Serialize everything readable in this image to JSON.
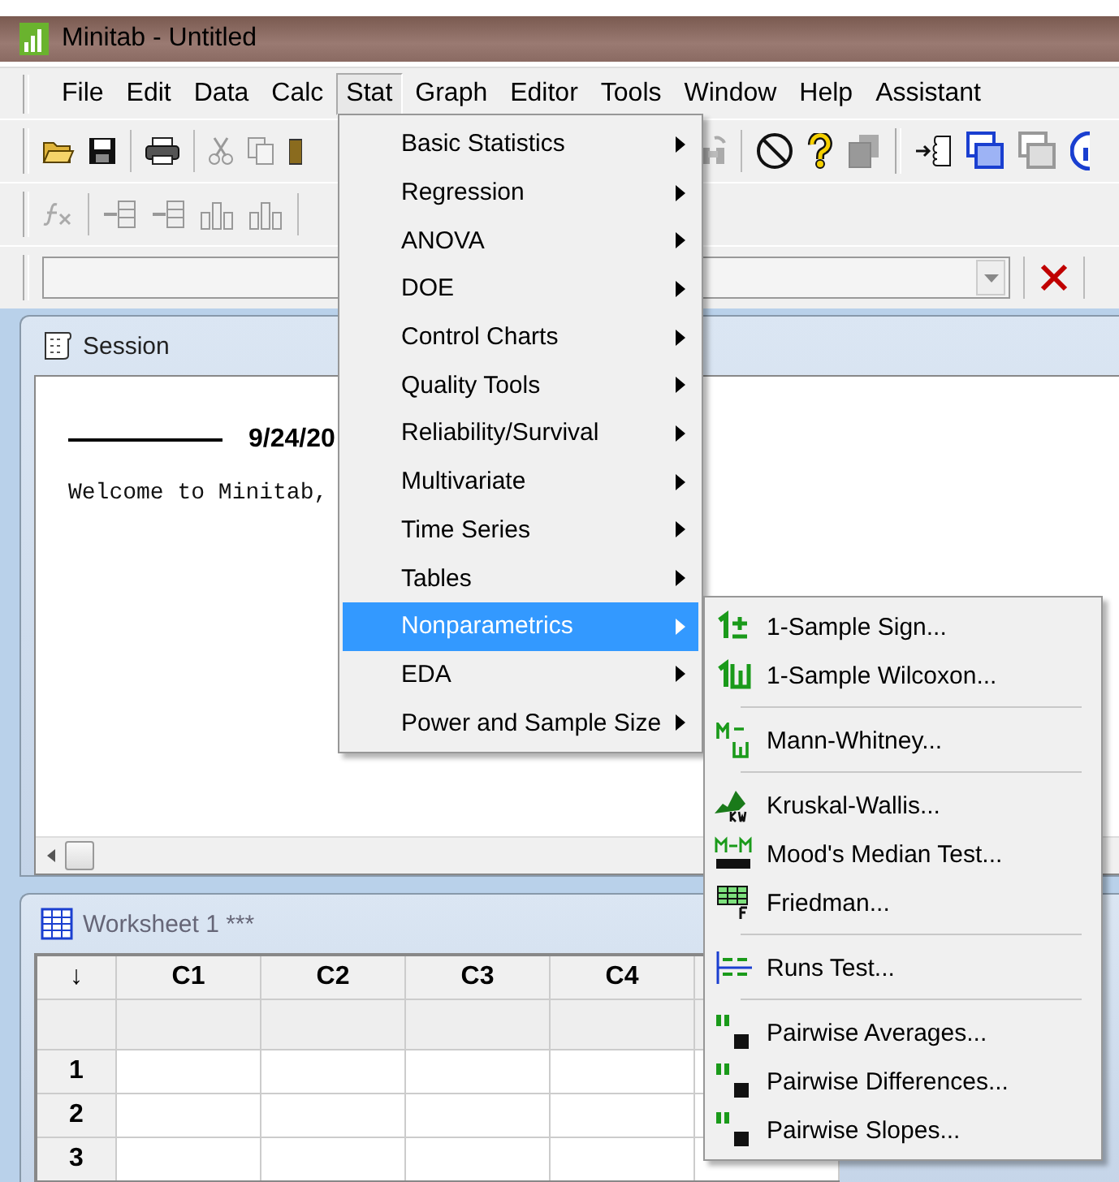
{
  "window": {
    "title": "Minitab - Untitled"
  },
  "menu_bar": [
    {
      "label": "File",
      "selected": false
    },
    {
      "label": "Edit",
      "selected": false
    },
    {
      "label": "Data",
      "selected": false
    },
    {
      "label": "Calc",
      "selected": false
    },
    {
      "label": "Stat",
      "selected": true
    },
    {
      "label": "Graph",
      "selected": false
    },
    {
      "label": "Editor",
      "selected": false
    },
    {
      "label": "Tools",
      "selected": false
    },
    {
      "label": "Window",
      "selected": false
    },
    {
      "label": "Help",
      "selected": false
    },
    {
      "label": "Assistant",
      "selected": false
    }
  ],
  "session": {
    "title": "Session",
    "date": "9/24/20",
    "welcome": "Welcome to Minitab,"
  },
  "worksheet": {
    "title": "Worksheet 1 ***",
    "corner": "↓",
    "columns": [
      "C1",
      "C2",
      "C3",
      "C4"
    ],
    "rows": [
      "1",
      "2",
      "3"
    ]
  },
  "stat_menu": [
    {
      "label": "Basic Statistics",
      "selected": false
    },
    {
      "label": "Regression",
      "selected": false
    },
    {
      "label": "ANOVA",
      "selected": false
    },
    {
      "label": "DOE",
      "selected": false
    },
    {
      "label": "Control Charts",
      "selected": false
    },
    {
      "label": "Quality Tools",
      "selected": false
    },
    {
      "label": "Reliability/Survival",
      "selected": false
    },
    {
      "label": "Multivariate",
      "selected": false
    },
    {
      "label": "Time Series",
      "selected": false
    },
    {
      "label": "Tables",
      "selected": false
    },
    {
      "label": "Nonparametrics",
      "selected": true
    },
    {
      "label": "EDA",
      "selected": false
    },
    {
      "label": "Power and Sample Size",
      "selected": false
    }
  ],
  "nonparametrics_menu": [
    {
      "kind": "sign",
      "label": "1-Sample Sign..."
    },
    {
      "kind": "wilcoxon",
      "label": "1-Sample Wilcoxon..."
    },
    {
      "kind": "separator"
    },
    {
      "kind": "mann",
      "label": "Mann-Whitney..."
    },
    {
      "kind": "separator"
    },
    {
      "kind": "kruskal",
      "label": "Kruskal-Wallis..."
    },
    {
      "kind": "mood",
      "label": "Mood's Median Test..."
    },
    {
      "kind": "friedman",
      "label": "Friedman..."
    },
    {
      "kind": "separator"
    },
    {
      "kind": "runs",
      "label": "Runs Test..."
    },
    {
      "kind": "separator"
    },
    {
      "kind": "pairwise",
      "label": "Pairwise Averages..."
    },
    {
      "kind": "pairwise",
      "label": "Pairwise Differences..."
    },
    {
      "kind": "pairwise",
      "label": "Pairwise Slopes..."
    }
  ]
}
